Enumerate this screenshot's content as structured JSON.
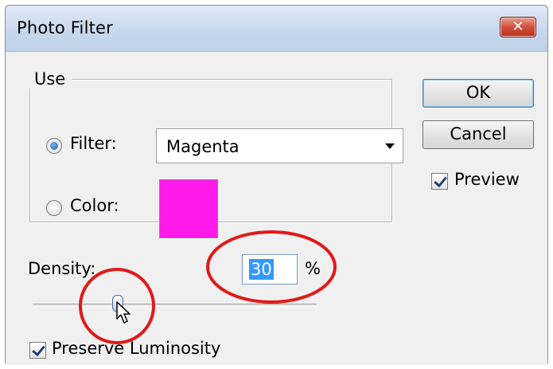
{
  "window": {
    "title": "Photo Filter",
    "close_glyph": "✕",
    "close_icon": "close-icon"
  },
  "use_group": {
    "legend": "Use",
    "filter": {
      "label": "Filter:",
      "selected": true,
      "value": "Magenta"
    },
    "color": {
      "label": "Color:",
      "selected": false,
      "swatch": "#ff1aea"
    }
  },
  "buttons": {
    "ok": "OK",
    "cancel": "Cancel"
  },
  "preview": {
    "label": "Preview",
    "checked": true
  },
  "density": {
    "label": "Density:",
    "value": "30",
    "unit": "%",
    "percent": 30
  },
  "preserve_luminosity": {
    "label": "Preserve Luminosity",
    "checked": true
  },
  "annotations": {
    "ring_color": "#e01a1a"
  },
  "colors": {
    "text_selection": "#3399ff",
    "default_button_border": "#3c7fb1"
  }
}
